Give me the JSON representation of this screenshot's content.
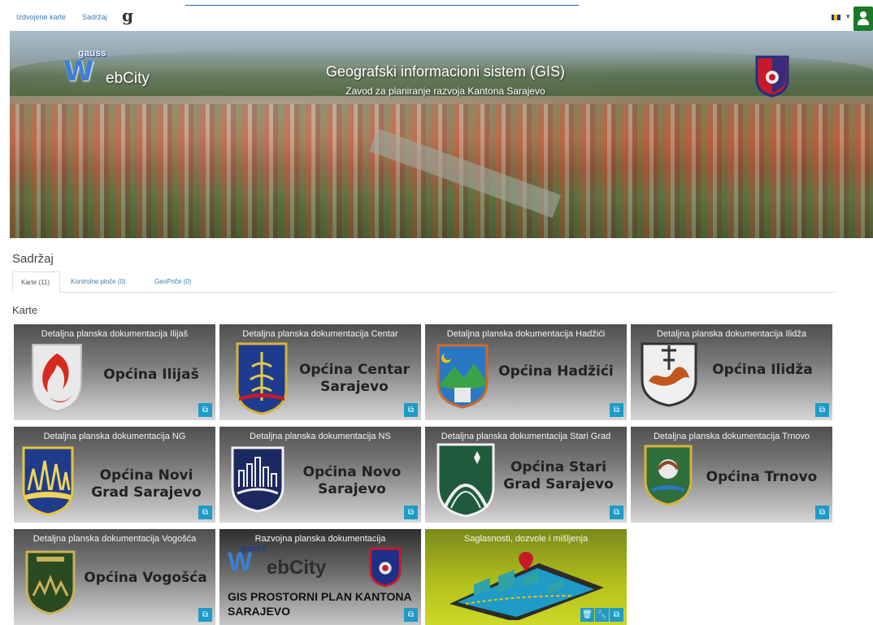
{
  "topbar": {
    "nav": [
      "Izdvojene karte",
      "Sadržaj"
    ],
    "brand_glyph": "g",
    "language_icon": "flag-icon",
    "user_icon": "user-icon"
  },
  "hero": {
    "logo_top": "gauss",
    "logo_w": "W",
    "logo_rest": "ebCity",
    "title": "Geografski informacioni sistem (GIS)",
    "subtitle": "Zavod za planiranje razvoja Kantona Sarajevo"
  },
  "content": {
    "title": "Sadržaj",
    "tabs": [
      "Karte (11)",
      "Kontrolne ploče (0)",
      "GeoPriče (0)"
    ],
    "section": "Karte"
  },
  "cards": [
    {
      "caption": "Detaljna planska dokumentacija Ilijaš",
      "name": "Općina Ilijaš"
    },
    {
      "caption": "Detaljna planska dokumentacija Centar",
      "name": "Općina Centar Sarajevo"
    },
    {
      "caption": "Detaljna planska dokumentacija Hadžići",
      "name": "Općina Hadžići"
    },
    {
      "caption": "Detaljna planska dokumentacija Ilidža",
      "name": "Općina Ilidža"
    },
    {
      "caption": "Detaljna planska dokumentacija NG",
      "name": "Općina Novi Grad Sarajevo"
    },
    {
      "caption": "Detaljna planska dokumentacija NS",
      "name": "Općina Novo Sarajevo"
    },
    {
      "caption": "Detaljna planska dokumentacija Stari Grad",
      "name": "Općina Stari Grad Sarajevo"
    },
    {
      "caption": "Detaljna planska dokumentacija Trnovo",
      "name": "Općina Trnovo"
    },
    {
      "caption": "Detaljna planska dokumentacija Vogošća",
      "name": "Općina Vogošća"
    },
    {
      "caption": "Razvojna planska dokumentacija",
      "name": "GIS PROSTORNI PLAN KANTONA SARAJEVO",
      "logo_top": "gauss",
      "logo_w": "W",
      "logo_rest": "ebCity"
    },
    {
      "caption": "Saglasnosti, dozvole i mišljenja",
      "name": ""
    }
  ],
  "colors": {
    "accent": "#1f9bc7",
    "link": "#3a7bb0",
    "user": "#1a7a26"
  }
}
